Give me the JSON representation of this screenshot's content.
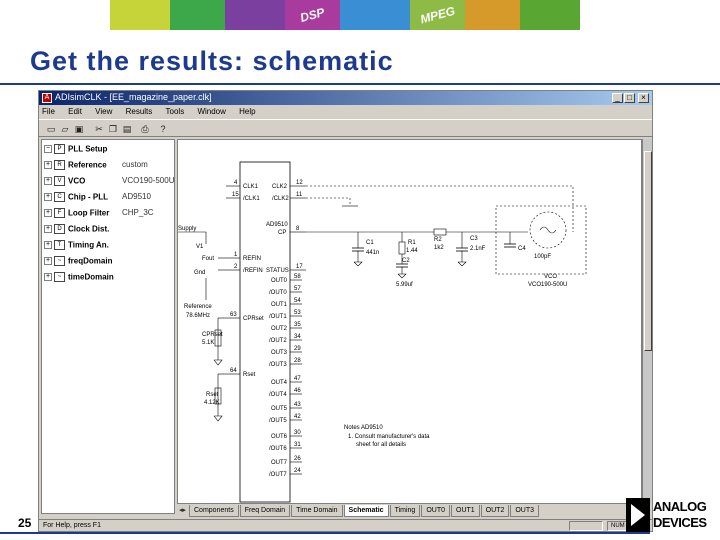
{
  "slide": {
    "title": "Get the results: schematic",
    "number": "25",
    "banner_labels": [
      "DSP",
      "MPEG"
    ],
    "logo_line1": "ANALOG",
    "logo_line2": "DEVICES",
    "accent_color": "#1d3a8f"
  },
  "window": {
    "title": "ADIsimCLK - [EE_magazine_paper.clk]",
    "menu": [
      "File",
      "Edit",
      "View",
      "Results",
      "Tools",
      "Window",
      "Help"
    ],
    "toolbar_icons": [
      "new-icon",
      "open-icon",
      "save-icon",
      "cut-icon",
      "copy-icon",
      "paste-icon",
      "print-icon",
      "help-icon"
    ]
  },
  "tree": {
    "root": "PLL Setup",
    "items": [
      {
        "label": "Reference",
        "value": "custom",
        "icon": "R"
      },
      {
        "label": "VCO",
        "value": "VCO190-500U",
        "icon": "V"
      },
      {
        "label": "Chip - PLL",
        "value": "AD9510",
        "icon": "C"
      },
      {
        "label": "Loop Filter",
        "value": "CHP_3C",
        "icon": "F"
      },
      {
        "label": "Clock Dist.",
        "value": "",
        "icon": "D"
      },
      {
        "label": "Timing An.",
        "value": "",
        "icon": "T"
      },
      {
        "label": "freqDomain",
        "value": "",
        "icon": "~"
      },
      {
        "label": "timeDomain",
        "value": "",
        "icon": "~"
      }
    ]
  },
  "schematic": {
    "chip_name": "AD9510",
    "left_pins": [
      {
        "num": "4",
        "name": "CLK1"
      },
      {
        "num": "15",
        "name": "/CLK1"
      },
      {
        "num": "1",
        "name": "REFIN"
      },
      {
        "num": "2",
        "name": "/REFIN"
      },
      {
        "num": "63",
        "name": "CPRset"
      },
      {
        "num": "64",
        "name": "Rset"
      }
    ],
    "right_top": [
      {
        "num": "12",
        "name": "CLK2"
      },
      {
        "num": "11",
        "name": "/CLK2"
      },
      {
        "num": "8",
        "name": "CP"
      },
      {
        "num": "17",
        "name": "STATUS"
      }
    ],
    "outputs": [
      {
        "num": "58",
        "name": "OUT0"
      },
      {
        "num": "57",
        "name": "/OUT0"
      },
      {
        "num": "54",
        "name": "OUT1"
      },
      {
        "num": "53",
        "name": "/OUT1"
      },
      {
        "num": "35",
        "name": "OUT2"
      },
      {
        "num": "34",
        "name": "/OUT2"
      },
      {
        "num": "29",
        "name": "OUT3"
      },
      {
        "num": "28",
        "name": "/OUT3"
      },
      {
        "num": "47",
        "name": "OUT4"
      },
      {
        "num": "46",
        "name": "/OUT4"
      },
      {
        "num": "43",
        "name": "OUT5"
      },
      {
        "num": "42",
        "name": "/OUT5"
      },
      {
        "num": "30",
        "name": "OUT6"
      },
      {
        "num": "31",
        "name": "/OUT6"
      },
      {
        "num": "26",
        "name": "OUT7"
      },
      {
        "num": "24",
        "name": "/OUT7"
      }
    ],
    "labels": {
      "supply": "Supply",
      "v1": "V1",
      "fout": "Fout",
      "gnd": "Gnd",
      "reference": "Reference",
      "ref_freq": "78.6MHz",
      "cprset": "CPRset",
      "cprset_val": "5.1K",
      "rset": "Rset",
      "rset_val": "4.12K",
      "c1": "C1",
      "c1_val": "441n",
      "r1": "R1",
      "r1_val": "1.44",
      "c2": "C2",
      "c2_val": "5.99uf",
      "r2": "R2",
      "r2_val": "1k2",
      "c3": "C3",
      "c3_val": "2.1nF",
      "c4": "C4",
      "c4_val": "100pF",
      "vco": "VCO",
      "vco_name": "VCO190-500U",
      "notes_title": "Notes AD9510",
      "notes_line1": "1. Consult manufacturer's data",
      "notes_line2": "sheet for all details"
    }
  },
  "tabs": [
    "Components",
    "Freq Domain",
    "Time Domain",
    "Schematic",
    "Timing",
    "OUT0",
    "OUT1",
    "OUT2",
    "OUT3"
  ],
  "active_tab": "Schematic",
  "statusbar": {
    "message": "For Help, press F1",
    "indicators": [
      "",
      "NUM"
    ]
  }
}
